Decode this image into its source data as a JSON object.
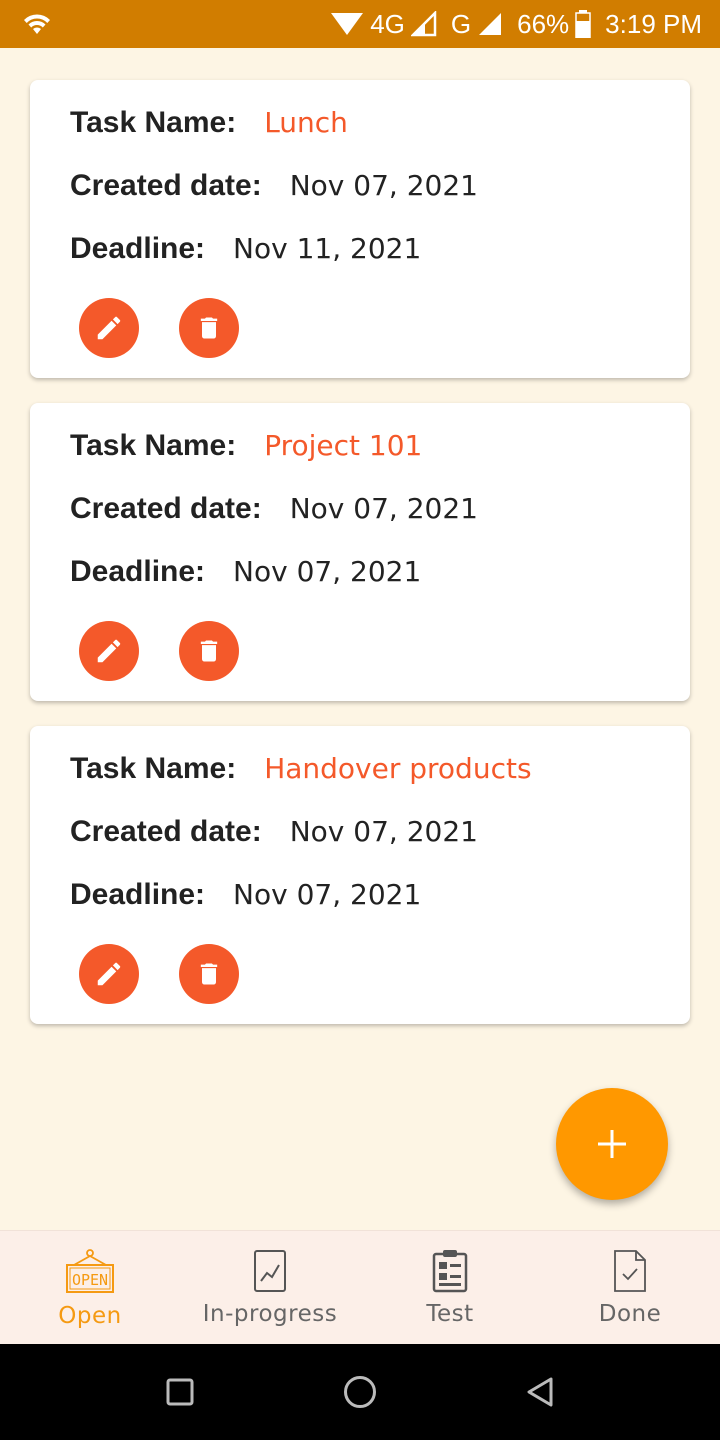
{
  "status_bar": {
    "network": "4G",
    "network2": "G",
    "battery": "66%",
    "time": "3:19 PM"
  },
  "labels": {
    "task_name": "Task Name:",
    "created_date": "Created date:",
    "deadline": "Deadline:"
  },
  "tasks": [
    {
      "name": "Lunch",
      "created": "Nov 07, 2021",
      "deadline": "Nov 11, 2021"
    },
    {
      "name": "Project 101",
      "created": "Nov 07, 2021",
      "deadline": "Nov 07, 2021"
    },
    {
      "name": "Handover products",
      "created": "Nov 07, 2021",
      "deadline": "Nov 07, 2021"
    }
  ],
  "bottom_nav": {
    "items": [
      {
        "label": "Open",
        "icon": "open-sign-icon",
        "active": true
      },
      {
        "label": "In-progress",
        "icon": "chart-line-icon",
        "active": false
      },
      {
        "label": "Test",
        "icon": "clipboard-icon",
        "active": false
      },
      {
        "label": "Done",
        "icon": "document-check-icon",
        "active": false
      }
    ]
  },
  "colors": {
    "status_bar": "#d17d00",
    "accent": "#f4592a",
    "fab": "#ff9800",
    "active_nav": "#f59a12",
    "background": "#fdf5e4"
  }
}
